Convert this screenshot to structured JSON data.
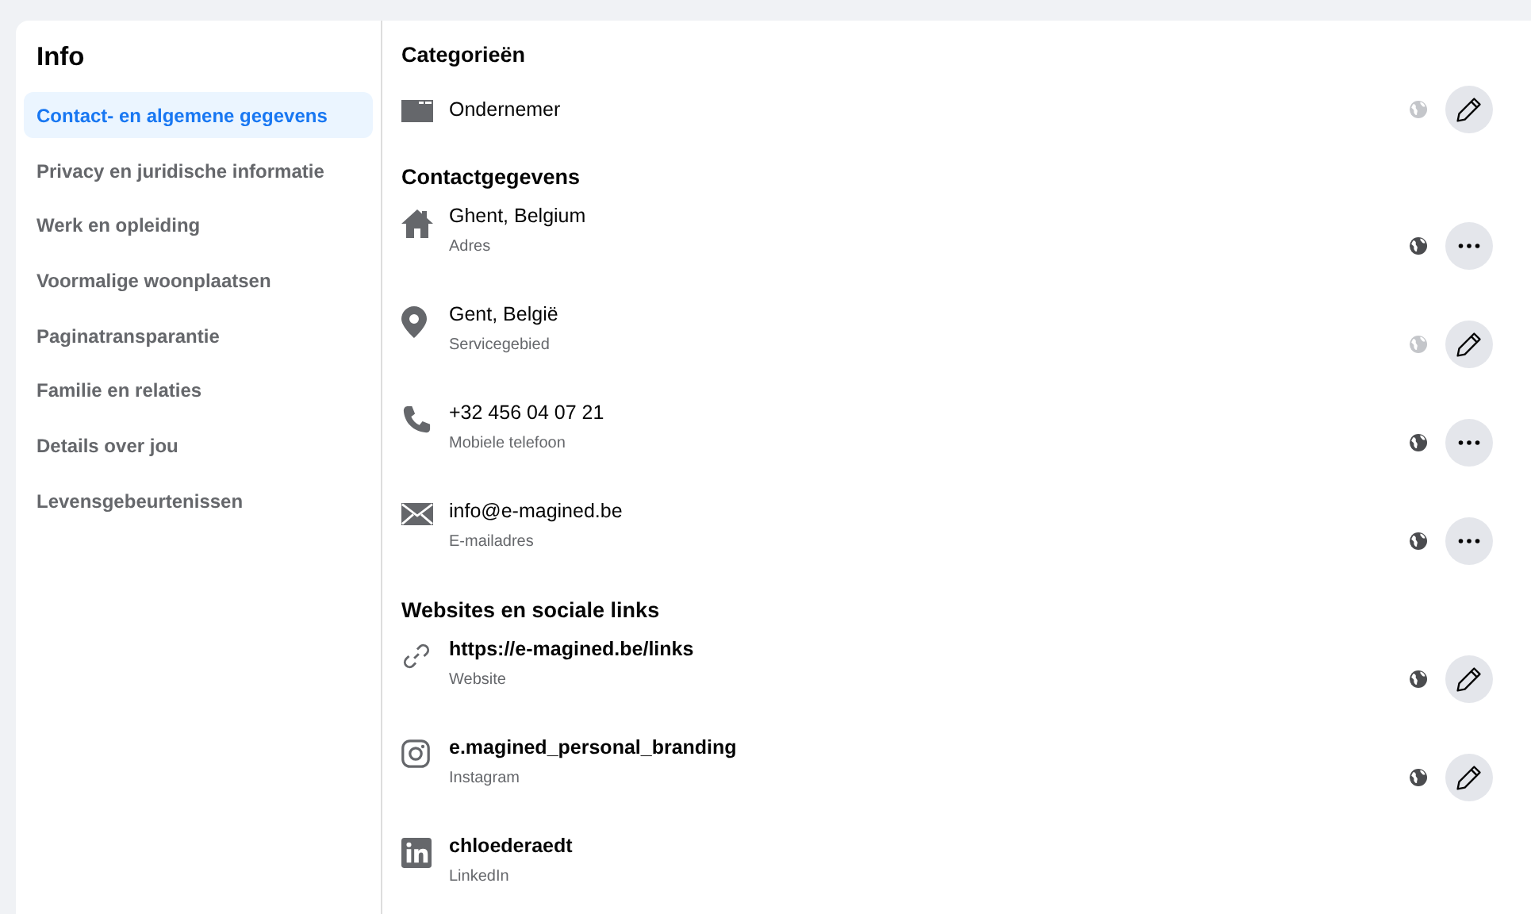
{
  "sidebar": {
    "title": "Info",
    "items": [
      {
        "label": "Contact- en algemene gegevens",
        "selected": true
      },
      {
        "label": "Privacy en juridische informatie",
        "selected": false
      },
      {
        "label": "Werk en opleiding",
        "selected": false
      },
      {
        "label": "Voormalige woonplaatsen",
        "selected": false
      },
      {
        "label": "Paginatransparantie",
        "selected": false
      },
      {
        "label": "Familie en relaties",
        "selected": false
      },
      {
        "label": "Details over jou",
        "selected": false
      },
      {
        "label": "Levensgebeurtenissen",
        "selected": false
      }
    ]
  },
  "sections": [
    {
      "title": "Categorieën",
      "items": [
        {
          "kind": "category",
          "value": "Ondernemer",
          "globe_dimmed": true,
          "button": {
            "kind": "edit"
          }
        }
      ]
    },
    {
      "title": "Contactgegevens",
      "items": [
        {
          "kind": "home",
          "value": "Ghent, Belgium",
          "label": "Adres",
          "globe_dimmed": false,
          "button": {
            "kind": "more"
          }
        },
        {
          "kind": "pin",
          "value": "Gent, België",
          "label": "Servicegebied",
          "globe_dimmed": true,
          "button": {
            "kind": "edit"
          }
        },
        {
          "kind": "phone",
          "value": "+32 456 04 07 21",
          "label": "Mobiele telefoon",
          "globe_dimmed": false,
          "button": {
            "kind": "more"
          }
        },
        {
          "kind": "mail",
          "value": "info@e-magined.be",
          "label": "E-mailadres",
          "globe_dimmed": false,
          "button": {
            "kind": "more"
          }
        }
      ]
    },
    {
      "title": "Websites en sociale links",
      "items": [
        {
          "kind": "link",
          "value": "https://e-magined.be/links",
          "label": "Website",
          "globe_dimmed": false,
          "button": {
            "kind": "edit"
          }
        },
        {
          "kind": "instagram",
          "value": "e.magined_personal_branding",
          "label": "Instagram",
          "globe_dimmed": false,
          "button": {
            "kind": "edit"
          }
        },
        {
          "kind": "linkedin",
          "value": "chloederaedt",
          "label": "LinkedIn"
        }
      ]
    }
  ]
}
